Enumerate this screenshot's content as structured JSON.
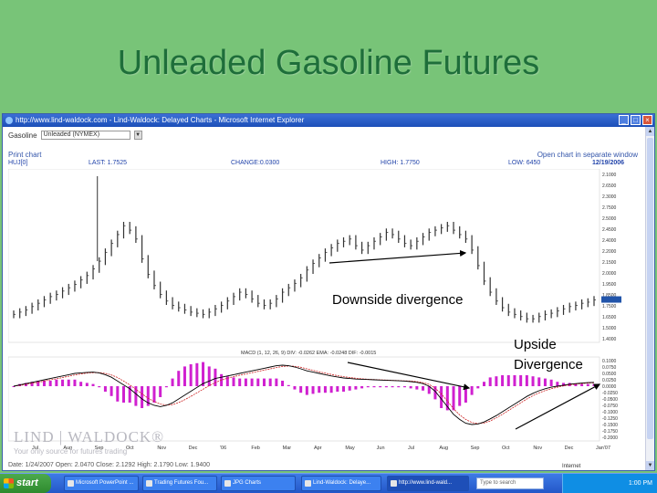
{
  "slide": {
    "title": "Unleaded Gasoline Futures"
  },
  "window": {
    "title": "http://www.lind-waldock.com - Lind-Waldock: Delayed Charts - Microsoft Internet Explorer",
    "min_label": "_",
    "max_label": "□",
    "close_label": "×"
  },
  "page": {
    "symbol_label": "Gasoline",
    "symbol_value": "Unleaded (NYMEX)",
    "print_link": "Print chart",
    "open_link": "Open chart in separate window",
    "status_line": "Date: 1/24/2007 Open: 2.0470 Close: 2.1292 High: 2.1790 Low: 1.9400"
  },
  "infobar": {
    "symbol": "HUJ[0]",
    "last": "LAST: 1.7525",
    "change": "CHANGE:0.0300",
    "high": "HIGH: 1.7750",
    "low": "LOW: 6450",
    "date": "12/19/2006"
  },
  "macd_label": "MACD (1, 12, 26, 9)  DIV: -0.0262  EMA: -0.0248  DIF: -0.0015",
  "logo": {
    "name": "LIND | WALDOCK®",
    "tag": "Your only source for futures trading"
  },
  "annotations": {
    "downside": "Downside divergence",
    "upside_line1": "Upside",
    "upside_line2": "Divergence"
  },
  "taskbar": {
    "start": "start",
    "items": [
      "Microsoft PowerPoint ...",
      "Trading Futures Fou...",
      "JPG Charts",
      "Lind-Waldock: Delaye...",
      "http://www.lind-wald..."
    ],
    "search_placeholder": "Type to search",
    "ie_status": "Internet",
    "clock": "1:00 PM"
  },
  "colors": {
    "background": "#78c478",
    "title": "#1e6e3a",
    "price_line": "#333333",
    "trend_arrow": "#000000",
    "macd_histogram": "#d020d0",
    "macd_line": "#000000",
    "signal_line": "#cc2222"
  },
  "chart_data": {
    "type": "line",
    "price_panel": {
      "x_ticks": [
        "Jul",
        "Aug",
        "Sep",
        "Oct",
        "Nov",
        "Dec",
        "'06",
        "Feb",
        "Mar",
        "Apr",
        "May",
        "Jun",
        "Jul",
        "Aug",
        "Sep",
        "Oct",
        "Nov",
        "Dec",
        "Jan'07"
      ],
      "y_ticks": [
        "2.1000",
        "2.6500",
        "2.3000",
        "2.7500",
        "2.5000",
        "2.4500",
        "2.4000",
        "2.2000",
        "2.1500",
        "2.0000",
        "1.9500",
        "1.8500",
        "1.7500",
        "1.6500",
        "1.5000",
        "1.4000"
      ],
      "ylim": [
        1.4,
        2.9
      ],
      "close": [
        1.62,
        1.64,
        1.66,
        1.69,
        1.72,
        1.75,
        1.78,
        1.8,
        1.83,
        1.86,
        1.89,
        1.93,
        1.97,
        2.03,
        2.1,
        2.18,
        2.26,
        2.34,
        2.42,
        2.38,
        2.3,
        2.12,
        1.98,
        1.88,
        1.8,
        1.74,
        1.7,
        1.68,
        1.66,
        1.64,
        1.63,
        1.62,
        1.64,
        1.67,
        1.7,
        1.74,
        1.78,
        1.82,
        1.8,
        1.76,
        1.72,
        1.7,
        1.72,
        1.76,
        1.82,
        1.86,
        1.9,
        1.95,
        2.02,
        2.08,
        2.13,
        2.18,
        2.22,
        2.26,
        2.28,
        2.3,
        2.24,
        2.2,
        2.24,
        2.28,
        2.32,
        2.36,
        2.34,
        2.3,
        2.26,
        2.24,
        2.28,
        2.32,
        2.36,
        2.38,
        2.4,
        2.42,
        2.38,
        2.34,
        2.3,
        2.2,
        2.06,
        1.92,
        1.82,
        1.74,
        1.68,
        1.64,
        1.62,
        1.6,
        1.58,
        1.58,
        1.6,
        1.62,
        1.63,
        1.65,
        1.67,
        1.69,
        1.7,
        1.72,
        1.73,
        1.75
      ]
    },
    "macd_panel": {
      "y_ticks": [
        "0.1000",
        "0.0750",
        "0.0500",
        "0.0250",
        "0.0000",
        "-0.0250",
        "-0.0500",
        "-0.0750",
        "-0.1000",
        "-0.1250",
        "-0.1500",
        "-0.1750",
        "-0.2000"
      ],
      "ylim": [
        -0.2,
        0.1
      ],
      "macd": [
        0.0,
        0.005,
        0.01,
        0.015,
        0.02,
        0.025,
        0.03,
        0.035,
        0.04,
        0.045,
        0.05,
        0.052,
        0.054,
        0.055,
        0.052,
        0.045,
        0.035,
        0.02,
        0.005,
        -0.01,
        -0.03,
        -0.05,
        -0.065,
        -0.075,
        -0.08,
        -0.075,
        -0.065,
        -0.05,
        -0.035,
        -0.02,
        -0.005,
        0.01,
        0.02,
        0.03,
        0.035,
        0.04,
        0.045,
        0.05,
        0.055,
        0.06,
        0.065,
        0.07,
        0.075,
        0.08,
        0.082,
        0.08,
        0.075,
        0.068,
        0.06,
        0.055,
        0.05,
        0.045,
        0.04,
        0.036,
        0.032,
        0.03,
        0.028,
        0.027,
        0.026,
        0.025,
        0.024,
        0.023,
        0.022,
        0.021,
        0.02,
        0.018,
        0.015,
        0.01,
        0.0,
        -0.02,
        -0.05,
        -0.08,
        -0.11,
        -0.13,
        -0.145,
        -0.15,
        -0.148,
        -0.14,
        -0.128,
        -0.115,
        -0.1,
        -0.085,
        -0.07,
        -0.055,
        -0.04,
        -0.028,
        -0.018,
        -0.01,
        -0.004,
        0.0,
        0.004,
        0.008,
        0.01,
        0.012,
        0.014,
        0.015
      ],
      "signal": [
        0.0,
        0.003,
        0.007,
        0.011,
        0.015,
        0.02,
        0.025,
        0.029,
        0.034,
        0.039,
        0.044,
        0.048,
        0.051,
        0.053,
        0.053,
        0.05,
        0.044,
        0.034,
        0.02,
        0.005,
        -0.012,
        -0.03,
        -0.047,
        -0.06,
        -0.07,
        -0.074,
        -0.072,
        -0.064,
        -0.053,
        -0.04,
        -0.026,
        -0.012,
        0.002,
        0.014,
        0.024,
        0.031,
        0.037,
        0.043,
        0.048,
        0.053,
        0.058,
        0.063,
        0.068,
        0.073,
        0.077,
        0.079,
        0.078,
        0.074,
        0.068,
        0.062,
        0.056,
        0.051,
        0.046,
        0.041,
        0.037,
        0.034,
        0.031,
        0.029,
        0.027,
        0.026,
        0.025,
        0.024,
        0.023,
        0.022,
        0.021,
        0.02,
        0.018,
        0.014,
        0.007,
        -0.008,
        -0.03,
        -0.058,
        -0.088,
        -0.112,
        -0.13,
        -0.142,
        -0.146,
        -0.144,
        -0.136,
        -0.124,
        -0.11,
        -0.095,
        -0.08,
        -0.065,
        -0.05,
        -0.037,
        -0.026,
        -0.017,
        -0.01,
        -0.004,
        0.001,
        0.005,
        0.008,
        0.01,
        0.012,
        0.013
      ]
    }
  }
}
